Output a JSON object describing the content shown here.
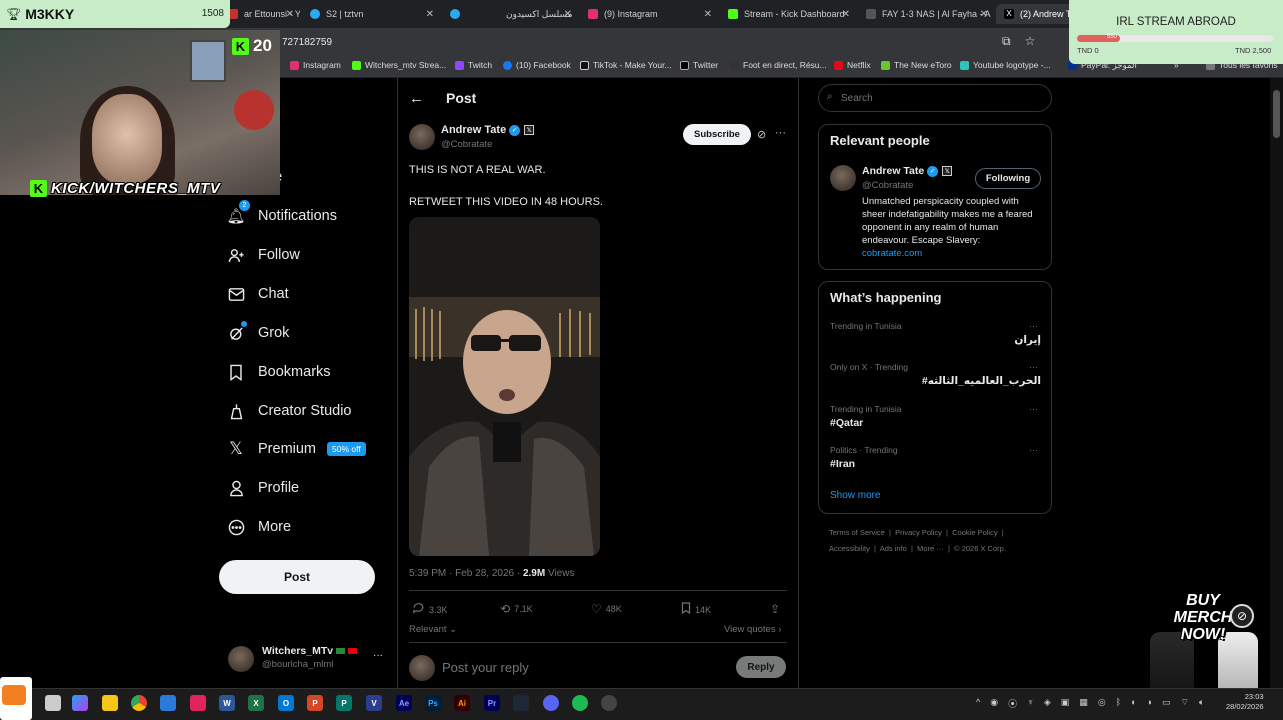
{
  "browser": {
    "tabs": [
      {
        "label": "ar Ettounsi - Y",
        "color": "#c4302b"
      },
      {
        "label": "S2 | tztvn",
        "color": "#2aabee"
      },
      {
        "label": "مسلسل اكسيدون",
        "color": "#2aabee"
      },
      {
        "label": "(9) Instagram",
        "color": "#e1306c"
      },
      {
        "label": "Stream - Kick Dashboard",
        "color": "#53fc18"
      },
      {
        "label": "FAY 1-3 NAS | Al Fayha - A",
        "color": "#555555"
      },
      {
        "label": "(2) Andrew Tat",
        "color": "#000000"
      }
    ],
    "url": "727182759",
    "bookmarks": [
      "Instagram",
      "Witchers_mtv Strea...",
      "Twitch",
      "(10) Facebook",
      "TikTok - Make Your...",
      "Twitter",
      "Foot en direct, Résu...",
      "Netflix",
      "The New eToro",
      "Youtube logotype -...",
      "PayPal: الموجز",
      "Tous les favoris"
    ]
  },
  "sidebar": {
    "items": [
      {
        "label": "Home",
        "visible_label": "me",
        "icon": "home-icon"
      },
      {
        "label": "Explore",
        "visible_label": "lore",
        "icon": "search-icon"
      },
      {
        "label": "Notifications",
        "icon": "bell-icon",
        "badge": "2"
      },
      {
        "label": "Follow",
        "icon": "person-add-icon"
      },
      {
        "label": "Chat",
        "icon": "mail-icon"
      },
      {
        "label": "Grok",
        "icon": "grok-icon"
      },
      {
        "label": "Bookmarks",
        "icon": "bookmark-icon"
      },
      {
        "label": "Creator Studio",
        "icon": "creator-studio-icon"
      },
      {
        "label": "Premium",
        "icon": "x-logo-icon",
        "badge": "50% off"
      },
      {
        "label": "Profile",
        "icon": "person-icon"
      },
      {
        "label": "More",
        "icon": "more-circle-icon"
      }
    ],
    "post_button": "Post",
    "account": {
      "name": "Witchers_MTv",
      "handle": "@bourlcha_mlml",
      "more": "···"
    }
  },
  "post": {
    "header": "Post",
    "author": {
      "name": "Andrew Tate",
      "handle": "@Cobratate",
      "badge": "𝕏"
    },
    "subscribe": "Subscribe",
    "text_lines": [
      "THIS IS NOT A REAL WAR.",
      "RETWEET THIS VIDEO IN 48 HOURS."
    ],
    "timestamp": "5:39 PM · Feb 28, 2026 · ",
    "views_count": "2.9M",
    "views_label": " Views",
    "stats": {
      "replies": "3.3K",
      "reposts": "7.1K",
      "likes": "48K",
      "bookmarks": "14K"
    },
    "relevant": "Relevant",
    "view_quotes": "View quotes",
    "reply_placeholder": "Post your reply",
    "reply_button": "Reply"
  },
  "right": {
    "search_placeholder": "Search",
    "relevant_people": {
      "title": "Relevant people",
      "name": "Andrew Tate",
      "handle": "@Cobratate",
      "button": "Following",
      "bio": "Unmatched perspicacity coupled with sheer indefatigability makes me a feared opponent in any realm of human endeavour. Escape Slavery:",
      "link": "cobratate.com"
    },
    "happening": {
      "title": "What’s happening",
      "trends": [
        {
          "context": "Trending in Tunisia",
          "name": "إيران"
        },
        {
          "context": "Only on X · Trending",
          "name": "#الحرب_العالميه_الثالثه"
        },
        {
          "context": "Trending in Tunisia",
          "name": "#Qatar"
        },
        {
          "context": "Politics · Trending",
          "name": "#Iran"
        }
      ],
      "show_more": "Show more"
    },
    "footer": {
      "line1": [
        "Terms of Service",
        "Privacy Policy",
        "Cookie Policy"
      ],
      "line2": [
        "Accessibility",
        "Ads info",
        "More ···",
        "© 2026 X Corp."
      ]
    }
  },
  "overlay": {
    "streamer": "M3KKY",
    "score": "1508",
    "kick_viewers": "20",
    "kick_handle": "KICK/WITCHERS_MTV",
    "goal": {
      "title": "IRL STREAM ABROAD",
      "min": "TND 0",
      "max": "TND 2,500",
      "mid": "550",
      "progress": 0.22
    },
    "merch": "BUY MERCH NOW!"
  },
  "taskbar": {
    "time": "23:03",
    "date": "28/02/2026"
  }
}
